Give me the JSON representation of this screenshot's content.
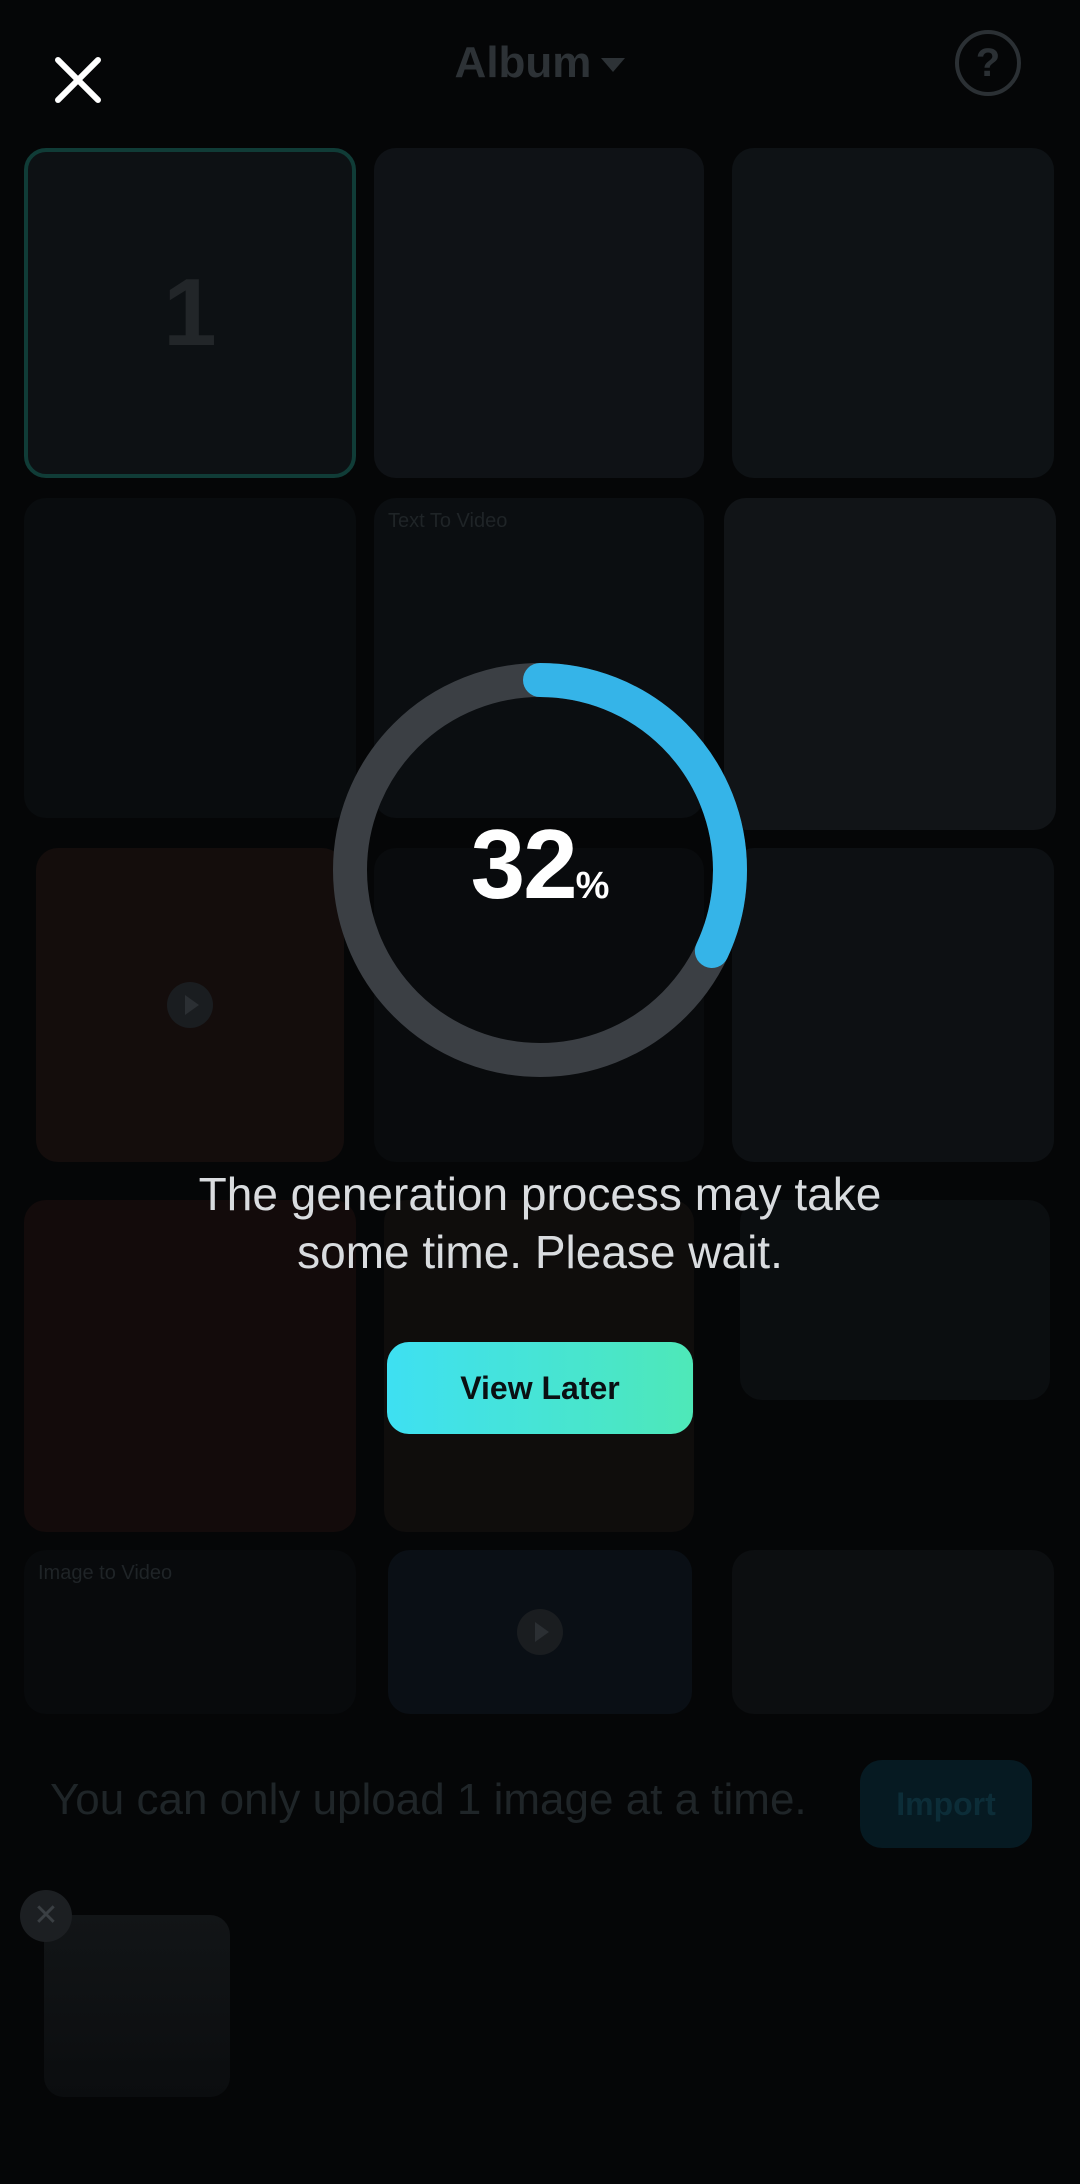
{
  "album": {
    "title": "Album",
    "help_glyph": "?",
    "selected_count": "1",
    "text_to_video_label": "Text To Video",
    "image_to_video_label": "Image to Video",
    "upload_hint": "You can only upload 1 image at a time.",
    "import_label": "Import"
  },
  "overlay": {
    "progress_value": "32",
    "progress_unit": "%",
    "progress_fraction": 0.32,
    "message_line1": "The generation process may take",
    "message_line2": "some time. Please wait.",
    "view_later_label": "View Later"
  },
  "colors": {
    "ring_track": "#3b3f44",
    "ring_progress": "#35b4e8",
    "button_gradient_start": "#3ee0f2",
    "button_gradient_end": "#4ee8b8"
  },
  "icons": {
    "close": "close-icon",
    "help": "help-icon",
    "dropdown": "chevron-down-icon",
    "play": "play-icon",
    "remove": "remove-icon"
  }
}
